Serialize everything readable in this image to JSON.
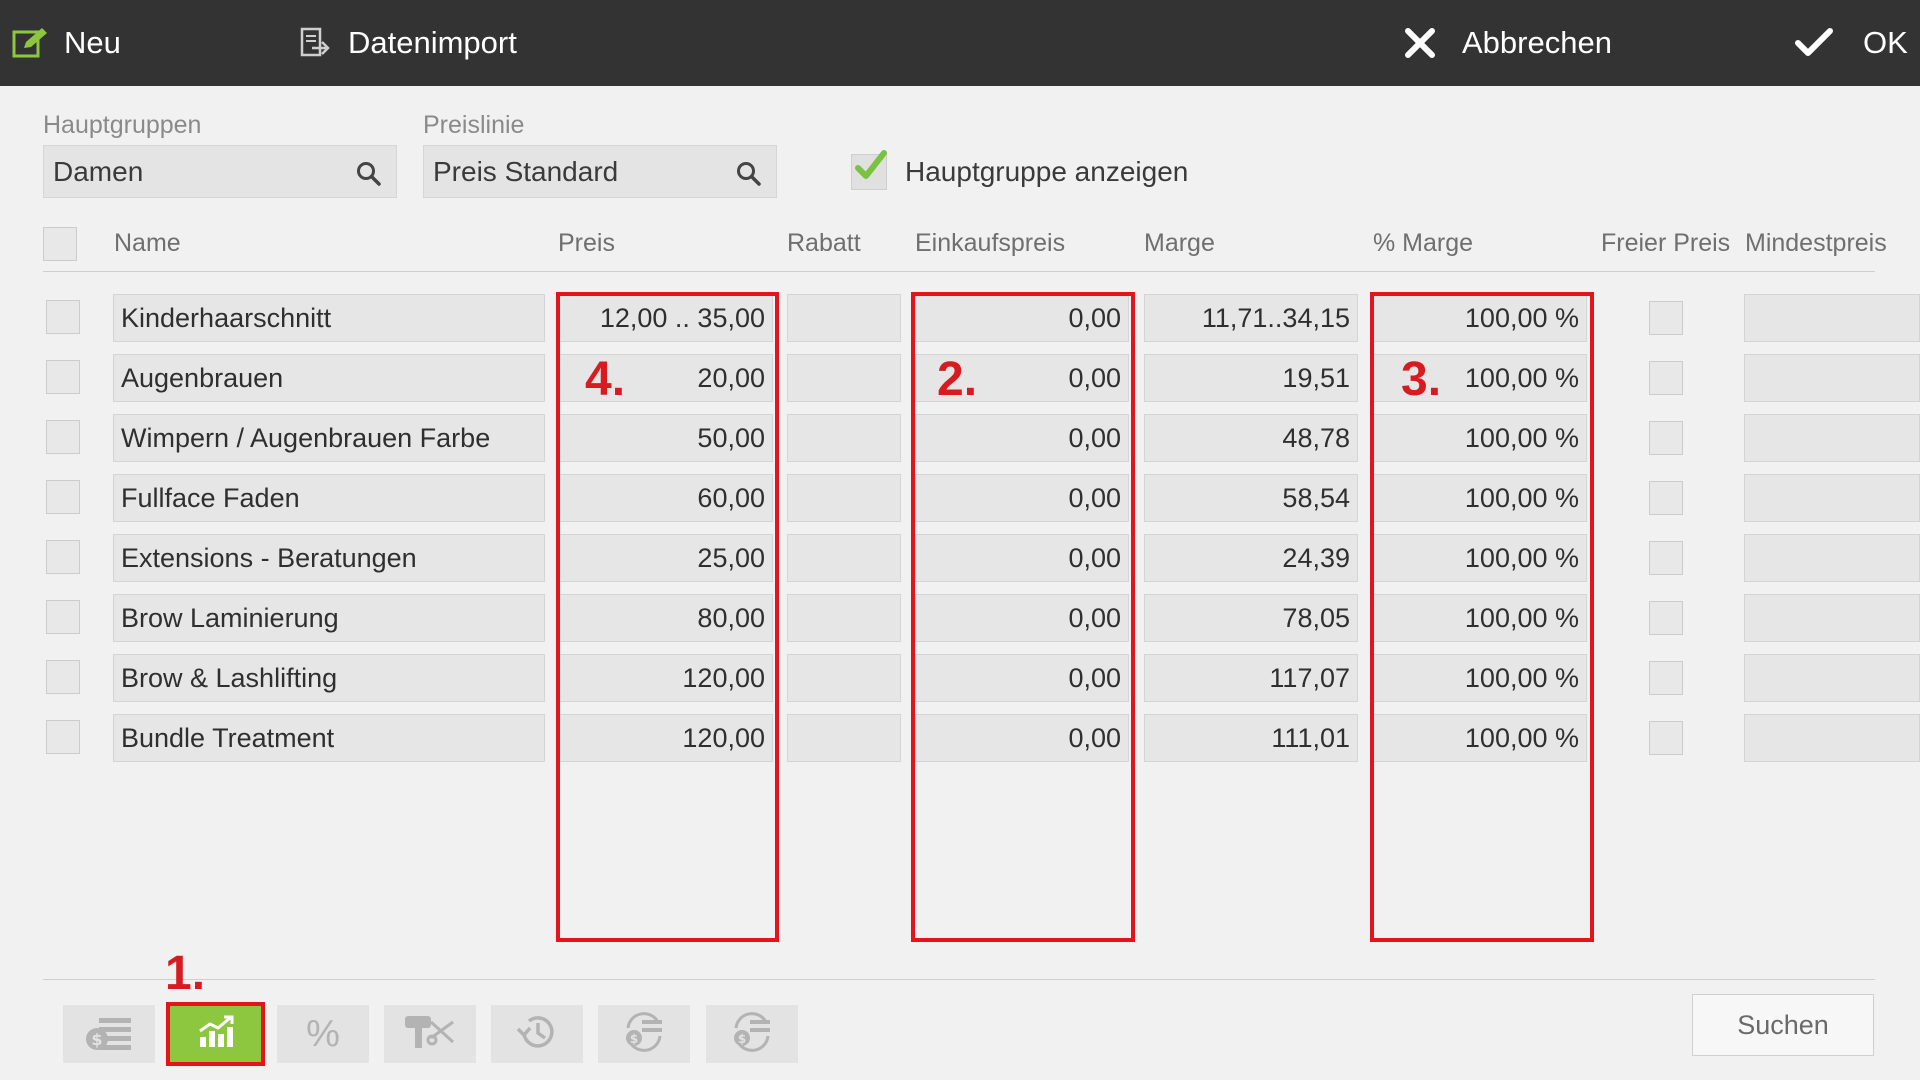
{
  "toolbar": {
    "new_label": "Neu",
    "import_label": "Datenimport",
    "cancel_label": "Abbrechen",
    "ok_label": "OK"
  },
  "filters": {
    "main_groups_label": "Hauptgruppen",
    "main_groups_value": "Damen",
    "price_line_label": "Preislinie",
    "price_line_value": "Preis Standard",
    "show_main_group_label": "Hauptgruppe anzeigen",
    "show_main_group_checked": true
  },
  "table": {
    "columns": [
      "Name",
      "Preis",
      "Rabatt",
      "Einkaufspreis",
      "Marge",
      "% Marge",
      "Freier Preis",
      "Mindestpreis"
    ],
    "rows": [
      {
        "name": "Kinderhaarschnitt",
        "preis": "12,00 .. 35,00",
        "rabatt": "",
        "einkaufspreis": "0,00",
        "marge": "11,71..34,15",
        "marge_pct": "100,00 %"
      },
      {
        "name": "Augenbrauen",
        "preis": "20,00",
        "rabatt": "",
        "einkaufspreis": "0,00",
        "marge": "19,51",
        "marge_pct": "100,00 %"
      },
      {
        "name": "Wimpern / Augenbrauen Farbe",
        "preis": "50,00",
        "rabatt": "",
        "einkaufspreis": "0,00",
        "marge": "48,78",
        "marge_pct": "100,00 %"
      },
      {
        "name": "Fullface Faden",
        "preis": "60,00",
        "rabatt": "",
        "einkaufspreis": "0,00",
        "marge": "58,54",
        "marge_pct": "100,00 %"
      },
      {
        "name": "Extensions - Beratungen",
        "preis": "25,00",
        "rabatt": "",
        "einkaufspreis": "0,00",
        "marge": "24,39",
        "marge_pct": "100,00 %"
      },
      {
        "name": "Brow Laminierung",
        "preis": "80,00",
        "rabatt": "",
        "einkaufspreis": "0,00",
        "marge": "78,05",
        "marge_pct": "100,00 %"
      },
      {
        "name": "Brow & Lashlifting",
        "preis": "120,00",
        "rabatt": "",
        "einkaufspreis": "0,00",
        "marge": "117,07",
        "marge_pct": "100,00 %"
      },
      {
        "name": "Bundle Treatment",
        "preis": "120,00",
        "rabatt": "",
        "einkaufspreis": "0,00",
        "marge": "111,01",
        "marge_pct": "100,00 %"
      }
    ]
  },
  "annotations": {
    "mark1": "1.",
    "mark2": "2.",
    "mark3": "3.",
    "mark4": "4."
  },
  "bottom": {
    "tools": [
      "money-list-icon",
      "chart-up-icon",
      "percent-icon",
      "dryer-scissors-icon",
      "history-icon",
      "refresh-money-icon",
      "refresh-money-icon"
    ],
    "active_tool": 1,
    "percent_symbol": "%",
    "search_label": "Suchen"
  },
  "colors": {
    "topbar": "#333333",
    "accent_green": "#8dc63f",
    "annotation_red": "#e2151d"
  }
}
